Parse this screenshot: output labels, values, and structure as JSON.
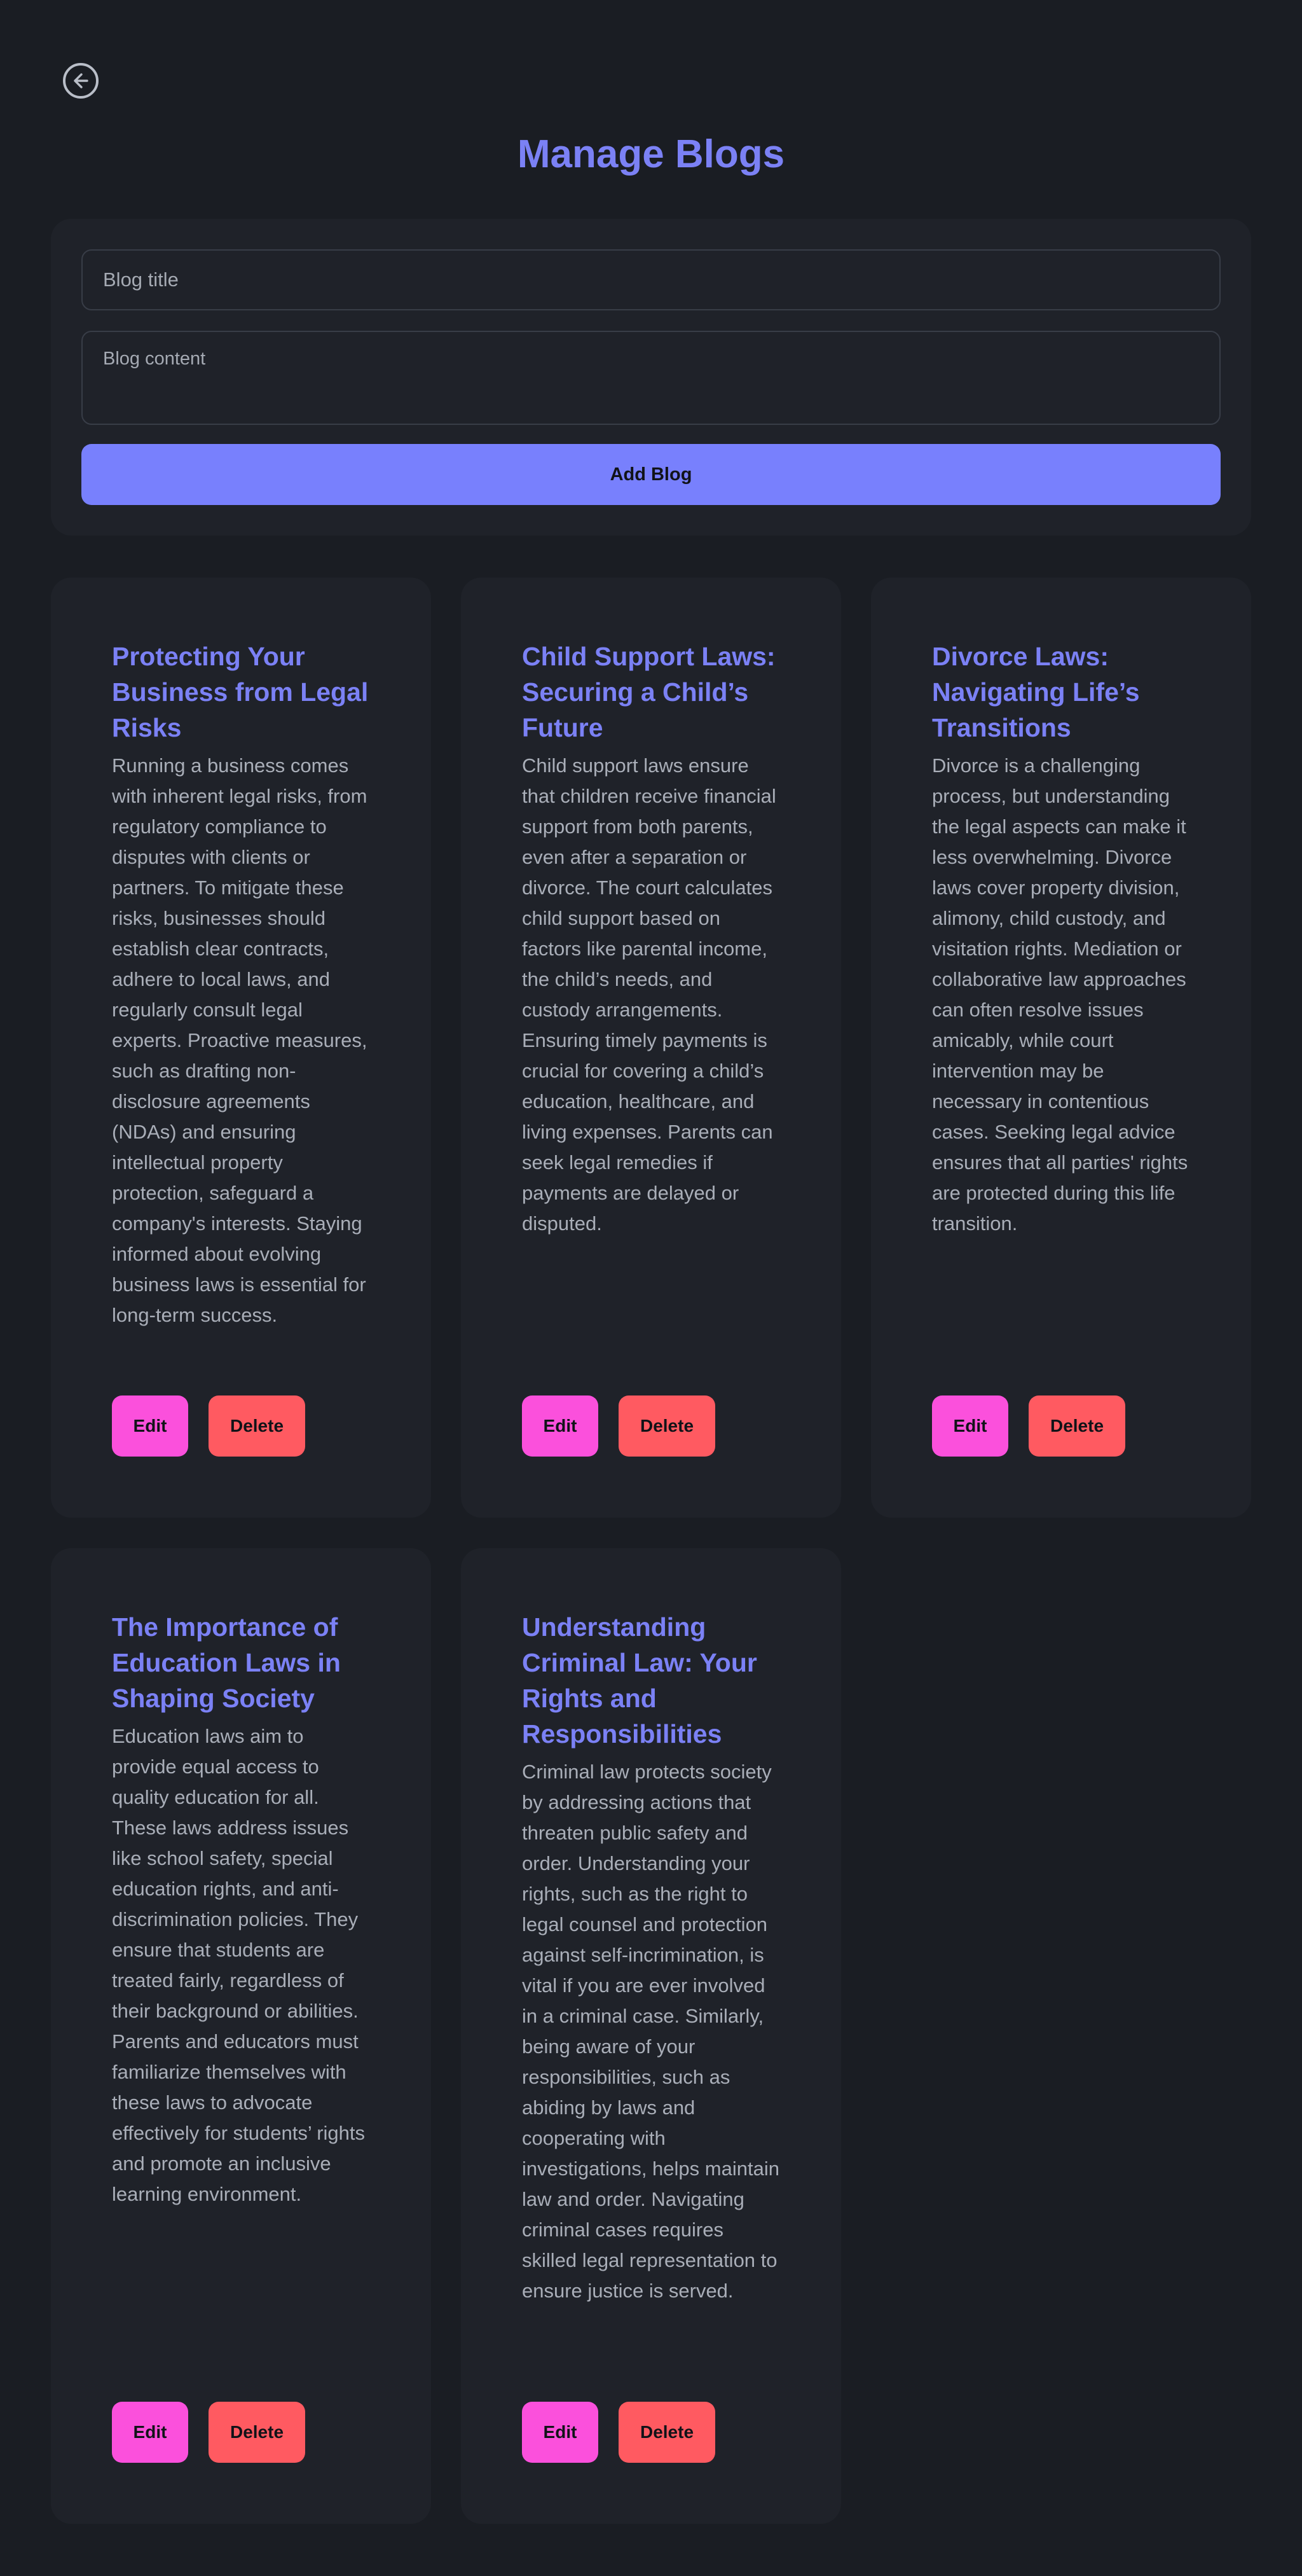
{
  "page": {
    "title": "Manage Blogs",
    "back_icon": "arrow-left-circle-icon"
  },
  "form": {
    "title_placeholder": "Blog title",
    "content_placeholder": "Blog content",
    "add_label": "Add Blog"
  },
  "colors": {
    "background": "#1a1d23",
    "panel": "#1f2229",
    "accent": "#7b81f5",
    "add_button": "#7880fd",
    "edit_button": "#fb50dc",
    "delete_button": "#ff5a61"
  },
  "posts": [
    {
      "title": "Protecting Your Business from Legal Risks",
      "content": "Running a business comes with inherent legal risks, from regulatory compliance to disputes with clients or partners. To mitigate these risks, businesses should establish clear contracts, adhere to local laws, and regularly consult legal experts. Proactive measures, such as drafting non-disclosure agreements (NDAs) and ensuring intellectual property protection, safeguard a company's interests. Staying informed about evolving business laws is essential for long-term success.",
      "edit_label": "Edit",
      "delete_label": "Delete"
    },
    {
      "title": "Child Support Laws: Securing a Child’s Future",
      "content": "Child support laws ensure that children receive financial support from both parents, even after a separation or divorce. The court calculates child support based on factors like parental income, the child’s needs, and custody arrangements. Ensuring timely payments is crucial for covering a child’s education, healthcare, and living expenses. Parents can seek legal remedies if payments are delayed or disputed.",
      "edit_label": "Edit",
      "delete_label": "Delete"
    },
    {
      "title": "Divorce Laws: Navigating Life’s Transitions",
      "content": "Divorce is a challenging process, but understanding the legal aspects can make it less overwhelming. Divorce laws cover property division, alimony, child custody, and visitation rights. Mediation or collaborative law approaches can often resolve issues amicably, while court intervention may be necessary in contentious cases. Seeking legal advice ensures that all parties' rights are protected during this life transition.",
      "edit_label": "Edit",
      "delete_label": "Delete"
    },
    {
      "title": "The Importance of Education Laws in Shaping Society",
      "content": "Education laws aim to provide equal access to quality education for all. These laws address issues like school safety, special education rights, and anti-discrimination policies. They ensure that students are treated fairly, regardless of their background or abilities. Parents and educators must familiarize themselves with these laws to advocate effectively for students’ rights and promote an inclusive learning environment.",
      "edit_label": "Edit",
      "delete_label": "Delete"
    },
    {
      "title": "Understanding Criminal Law: Your Rights and Responsibilities",
      "content": "Criminal law protects society by addressing actions that threaten public safety and order. Understanding your rights, such as the right to legal counsel and protection against self-incrimination, is vital if you are ever involved in a criminal case. Similarly, being aware of your responsibilities, such as abiding by laws and cooperating with investigations, helps maintain law and order. Navigating criminal cases requires skilled legal representation to ensure justice is served.",
      "edit_label": "Edit",
      "delete_label": "Delete"
    }
  ]
}
